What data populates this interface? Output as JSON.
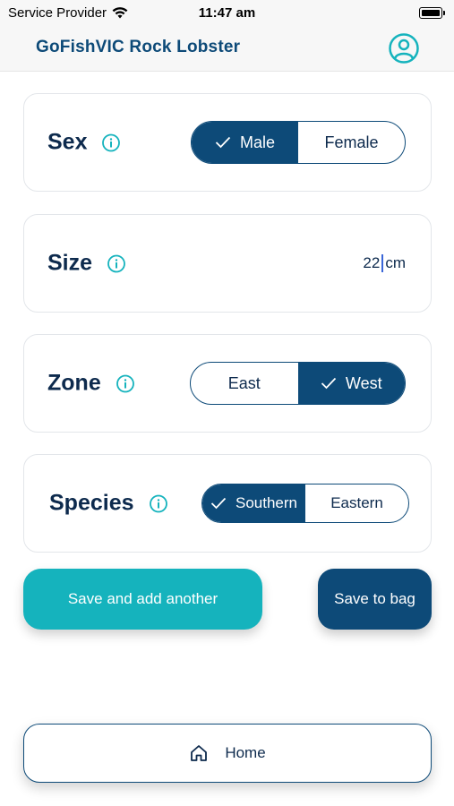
{
  "status_bar": {
    "carrier": "Service Provider",
    "time": "11:47 am"
  },
  "header": {
    "title": "GoFishVIC Rock Lobster",
    "profile_icon": "user-circle-icon"
  },
  "fields": {
    "sex": {
      "label": "Sex",
      "options": [
        "Male",
        "Female"
      ],
      "selected": "Male"
    },
    "size": {
      "label": "Size",
      "value": "22",
      "unit": "cm"
    },
    "zone": {
      "label": "Zone",
      "options": [
        "East",
        "West"
      ],
      "selected": "West"
    },
    "species": {
      "label": "Species",
      "options": [
        "Southern",
        "Eastern"
      ],
      "selected": "Southern"
    }
  },
  "actions": {
    "save_add_label": "Save and add another",
    "save_bag_label": "Save to bag"
  },
  "footer": {
    "home_label": "Home",
    "home_icon": "home-icon"
  },
  "colors": {
    "primary": "#0d4a78",
    "accent": "#15b3bd",
    "text": "#0d2a4d"
  }
}
